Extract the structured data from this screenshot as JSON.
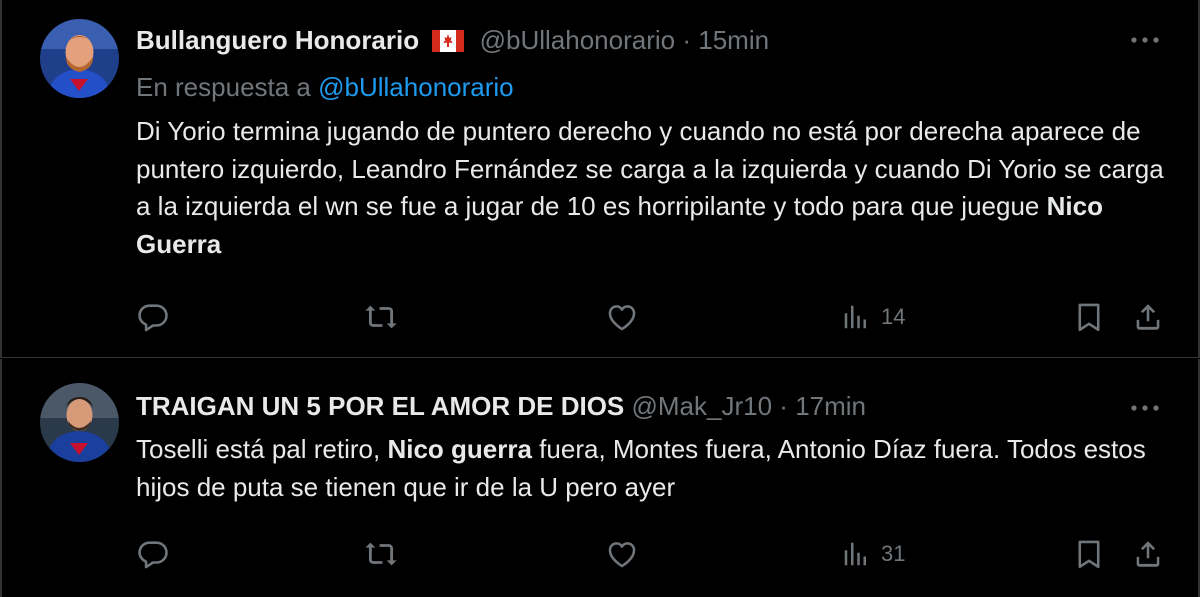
{
  "tweets": [
    {
      "display_name": "Bullanguero Honorario",
      "flag": "canada-flag",
      "handle": "@bUllahonorario",
      "separator": "·",
      "time": "15min",
      "reply_prefix": "En respuesta a ",
      "reply_mention": "@bUllahonorario",
      "text_before": "Di Yorio termina jugando de puntero derecho y cuando no está por derecha aparece de puntero izquierdo, Leandro Fernández se carga a la izquierda y cuando Di Yorio se carga a la izquierda el wn se fue a jugar de 10 es horripilante y todo para que juegue ",
      "text_bold": "Nico Guerra",
      "text_after": "",
      "views": "14"
    },
    {
      "display_name": "TRAIGAN UN 5 POR EL AMOR DE DIOS",
      "handle": "@Mak_Jr10",
      "separator": "·",
      "time": "17min",
      "text_before": "Toselli está pal retiro, ",
      "text_bold": "Nico guerra",
      "text_after": " fuera, Montes fuera, Antonio Díaz fuera. Todos estos hijos de puta se tienen que ir de la U pero ayer",
      "views": "31"
    }
  ],
  "colors": {
    "background": "#000000",
    "text": "#e7e9ea",
    "secondary": "#71767b",
    "link": "#1d9bf0",
    "divider": "#2f3336"
  },
  "icons": [
    "reply-icon",
    "retweet-icon",
    "like-icon",
    "views-icon",
    "bookmark-icon",
    "share-icon",
    "more-icon"
  ]
}
